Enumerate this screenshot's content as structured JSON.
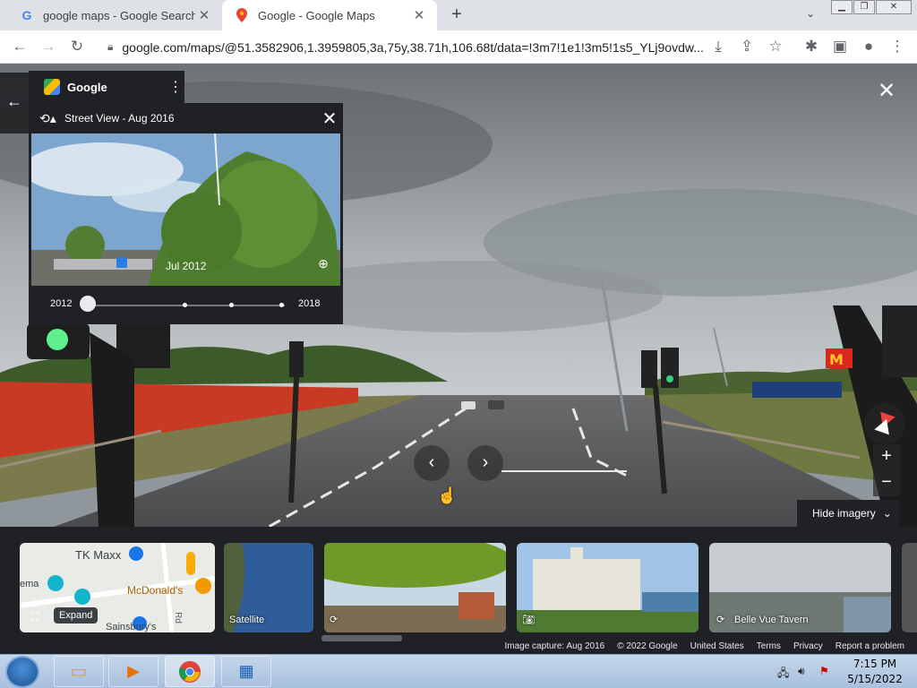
{
  "browser": {
    "tabs": [
      {
        "title": "google maps - Google Search",
        "favicon": "google-g-icon",
        "active": false
      },
      {
        "title": "Google - Google Maps",
        "favicon": "maps-pin-icon",
        "active": true
      }
    ],
    "new_tab": "+",
    "url": "google.com/maps/@51.3582906,1.3959805,3a,75y,38.71h,106.68t/data=!3m7!1e1!3m5!1s5_YLj9ovdw..."
  },
  "place_card": {
    "name": "Google"
  },
  "time_machine": {
    "header": "Street View - Aug 2016",
    "preview_date": "Jul 2012",
    "start_year": "2012",
    "end_year": "2018"
  },
  "hide_imagery": "Hide imagery",
  "filmstrip": {
    "map_labels": {
      "tk_maxx": "TK Maxx",
      "mcdonalds": "McDonald's",
      "ema": "ema",
      "sainsburys": "Sainsbury's",
      "rd": "Rd"
    },
    "expand": "Expand",
    "satellite": "Satellite",
    "place": "Belle Vue Tavern"
  },
  "footer": {
    "capture": "Image capture: Aug 2016",
    "copyright": "© 2022 Google",
    "country": "United States",
    "terms": "Terms",
    "privacy": "Privacy",
    "report": "Report a problem"
  },
  "taskbar": {
    "time": "7:15 PM",
    "date": "5/15/2022"
  },
  "colors": {
    "accent": "#1a73e8",
    "panel": "#202124",
    "mcdonalds": "#da291c"
  }
}
